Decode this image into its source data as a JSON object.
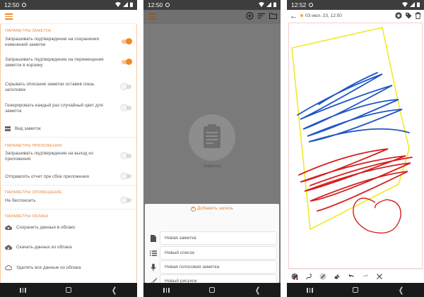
{
  "colors": {
    "accent": "#f28a1e",
    "statusbar": "#3d3d3d",
    "navbar": "#1a1a1a",
    "overlay": "#7a7a7a",
    "blue": "#1f56c7",
    "red": "#d51f1f",
    "yellow": "#f2e82a"
  },
  "screen1": {
    "time": "12:50",
    "sections": [
      {
        "title": "ПАРАМЕТРЫ ЗАМЕТОК"
      },
      {
        "title": "ПАРАМЕТРЫ ПРИЛОЖЕНИЯ"
      },
      {
        "title": "ПАРАМЕТРЫ ОПОВЕЩЕНИЕ"
      },
      {
        "title": "ПАРАМЕТРЫ ОБЛАКА"
      }
    ],
    "settings": [
      {
        "label": "Запрашивать подтверждение на сохранения изменений заметки",
        "on": true
      },
      {
        "label": "Запрашивать подтверждение на перемещения заметок в корзину",
        "on": true
      },
      {
        "label": "Скрывать описание заметки оставив лишь заголовок",
        "on": false
      },
      {
        "label": "Генерировать каждый раз случайный цвет для заметок",
        "on": false
      },
      {
        "label": "Вид заметок",
        "icon": "view-list-icon"
      },
      {
        "label": "Запрашивать подтверждение на выход из приложения",
        "on": false
      },
      {
        "label": "Отправлять отчет при сбое приложения",
        "on": false
      },
      {
        "label": "Не беспокоить",
        "on": false
      },
      {
        "label": "Сохранить данные в облако",
        "icon": "cloud-upload-icon"
      },
      {
        "label": "Скачать данных из облака",
        "icon": "cloud-download-icon"
      },
      {
        "label": "Удалить все данные из облака",
        "icon": "cloud-delete-icon"
      }
    ]
  },
  "screen2": {
    "time": "12:50",
    "empty_label": "Заметок",
    "sheet_title": "Добавить запись",
    "sheet_dots": "···",
    "items": [
      {
        "label": "Новая заметка",
        "icon": "note-icon"
      },
      {
        "label": "Новый список",
        "icon": "list-icon"
      },
      {
        "label": "Новая голосовая заметка",
        "icon": "microphone-icon"
      },
      {
        "label": "Новый рисунок",
        "icon": "brush-icon"
      }
    ]
  },
  "screen3": {
    "time": "12:52",
    "date": "03 июл. 23, 12:50",
    "tools": [
      "palette-icon",
      "pen-settings-icon",
      "brush-style-icon",
      "eraser-icon",
      "undo-icon",
      "redo-icon",
      "close-icon"
    ]
  }
}
